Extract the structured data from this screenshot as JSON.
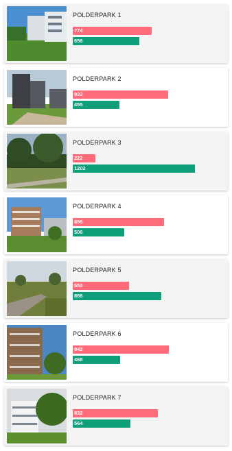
{
  "colors": {
    "pink": "#ff6b78",
    "green": "#0e9e7a"
  },
  "scale_max": 1320,
  "parks": [
    {
      "name": "POLDERPARK 1",
      "pink": 774,
      "green": 656
    },
    {
      "name": "POLDERPARK 2",
      "pink": 933,
      "green": 455
    },
    {
      "name": "POLDERPARK 3",
      "pink": 222,
      "green": 1202
    },
    {
      "name": "POLDERPARK 4",
      "pink": 896,
      "green": 506
    },
    {
      "name": "POLDERPARK 5",
      "pink": 553,
      "green": 866
    },
    {
      "name": "POLDERPARK 6",
      "pink": 942,
      "green": 468
    },
    {
      "name": "POLDERPARK 7",
      "pink": 832,
      "green": 564
    }
  ]
}
